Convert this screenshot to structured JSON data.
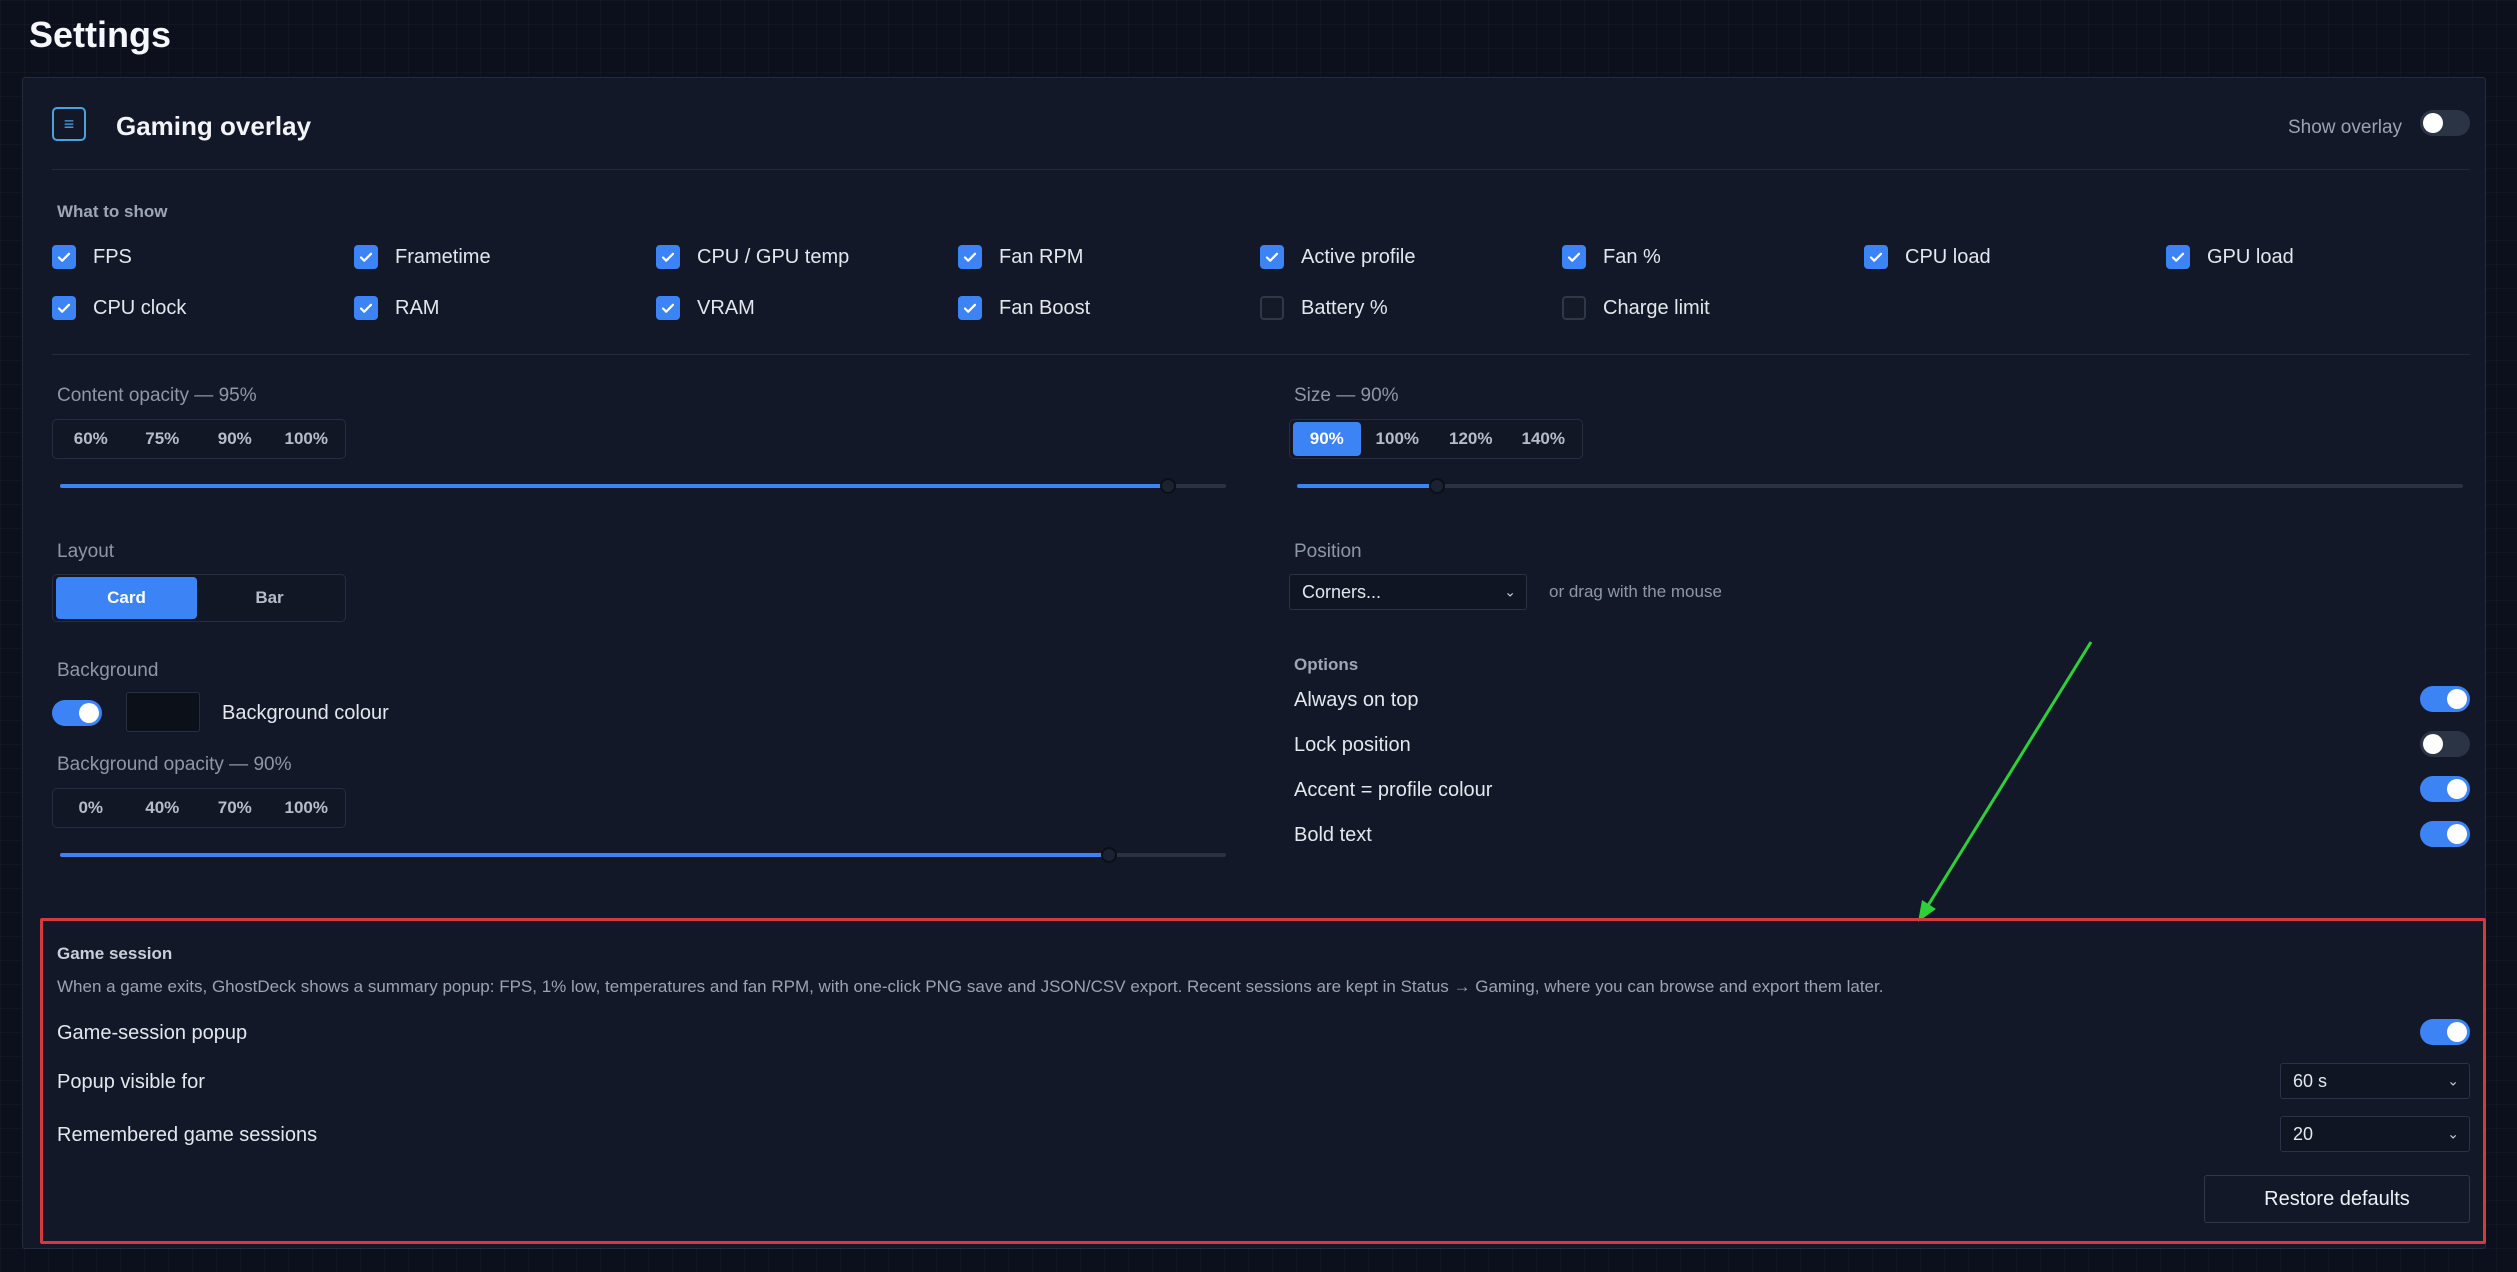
{
  "page": {
    "title": "Settings"
  },
  "overlay": {
    "title": "Gaming overlay",
    "icon": "overlay-list-icon",
    "show_overlay_label": "Show overlay",
    "show_overlay_on": false
  },
  "what_to_show": {
    "heading": "What to show",
    "items": [
      {
        "label": "FPS",
        "checked": true
      },
      {
        "label": "Frametime",
        "checked": true
      },
      {
        "label": "CPU / GPU temp",
        "checked": true
      },
      {
        "label": "Fan RPM",
        "checked": true
      },
      {
        "label": "Active profile",
        "checked": true
      },
      {
        "label": "Fan %",
        "checked": true
      },
      {
        "label": "CPU load",
        "checked": true
      },
      {
        "label": "GPU load",
        "checked": true
      },
      {
        "label": "CPU clock",
        "checked": true
      },
      {
        "label": "RAM",
        "checked": true
      },
      {
        "label": "VRAM",
        "checked": true
      },
      {
        "label": "Fan Boost",
        "checked": true
      },
      {
        "label": "Battery %",
        "checked": false
      },
      {
        "label": "Charge limit",
        "checked": false
      }
    ]
  },
  "content_opacity": {
    "label": "Content opacity — 95%",
    "presets": [
      "60%",
      "75%",
      "90%",
      "100%"
    ],
    "value_percent": 95
  },
  "size": {
    "label": "Size — 90%",
    "presets": [
      "90%",
      "100%",
      "120%",
      "140%"
    ],
    "active": "90%",
    "value_percent": 90
  },
  "layout": {
    "label": "Layout",
    "options": [
      "Card",
      "Bar"
    ],
    "active": "Card"
  },
  "position": {
    "label": "Position",
    "select_value": "Corners...",
    "hint": "or drag with the mouse"
  },
  "background": {
    "label": "Background",
    "enabled": true,
    "colour_label": "Background colour",
    "colour": "#0c1019",
    "opacity_label": "Background opacity — 90%",
    "opacity_presets": [
      "0%",
      "40%",
      "70%",
      "100%"
    ],
    "opacity_percent": 90
  },
  "options": {
    "heading": "Options",
    "items": [
      {
        "label": "Always on top",
        "on": true
      },
      {
        "label": "Lock position",
        "on": false
      },
      {
        "label": "Accent = profile colour",
        "on": true
      },
      {
        "label": "Bold text",
        "on": true
      }
    ]
  },
  "game_session": {
    "heading": "Game session",
    "description": "When a game exits, GhostDeck shows a summary popup: FPS, 1% low, temperatures and fan RPM, with one-click PNG save and JSON/CSV export. Recent sessions are kept in Status → Gaming, where you can browse and export them later.",
    "popup_label": "Game-session popup",
    "popup_on": true,
    "visible_for_label": "Popup visible for",
    "visible_for_value": "60 s",
    "remembered_label": "Remembered game sessions",
    "remembered_value": "20",
    "restore_label": "Restore defaults"
  },
  "colors": {
    "accent": "#3c83f6",
    "highlight_box": "#d23a3f",
    "arrow": "#2fcf3a"
  }
}
